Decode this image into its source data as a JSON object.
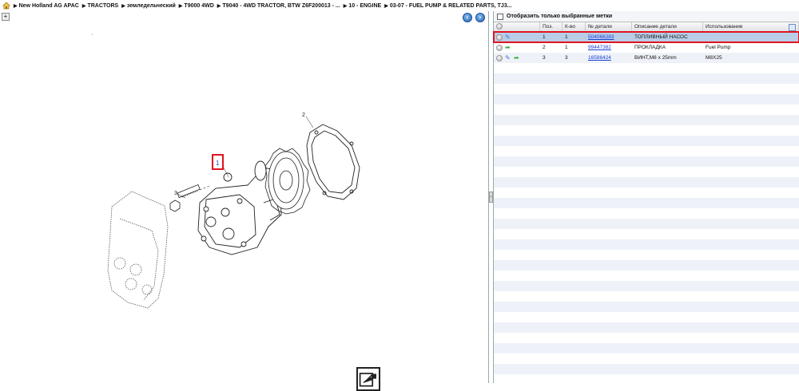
{
  "breadcrumb": [
    "New Holland AG APAC",
    "TRACTORS",
    "земледельческий",
    "T9000 4WD",
    "T9040 - 4WD TRACTOR, BTW Z6F200013 - ...",
    "10 - ENGINE",
    "03-07 - FUEL PUMP & RELATED PARTS, TJ3..."
  ],
  "filter": {
    "label": "Отобразить только выбранные метки"
  },
  "grid": {
    "headers": [
      "",
      "Поз.",
      "К-во",
      "№ детали",
      "Описание детали",
      "Использование"
    ],
    "rows": [
      {
        "pos": "1",
        "qty": "1",
        "part": "504066283",
        "desc": "ТОПЛИВНЫЙ НАСОС",
        "usage": ""
      },
      {
        "pos": "2",
        "qty": "1",
        "part": "99447382",
        "desc": "ПРОКЛАДКА",
        "usage": "Fuel Pump"
      },
      {
        "pos": "3",
        "qty": "3",
        "part": "16586424",
        "desc": "ВИНТ,M8 x 25mm",
        "usage": "M8X25"
      }
    ]
  },
  "diagram": {
    "callouts": [
      "1",
      "2",
      "3"
    ]
  },
  "colors": {
    "selection_outline": "#e0141e",
    "link": "#1a3fd6",
    "accent": "#2a67b8"
  }
}
